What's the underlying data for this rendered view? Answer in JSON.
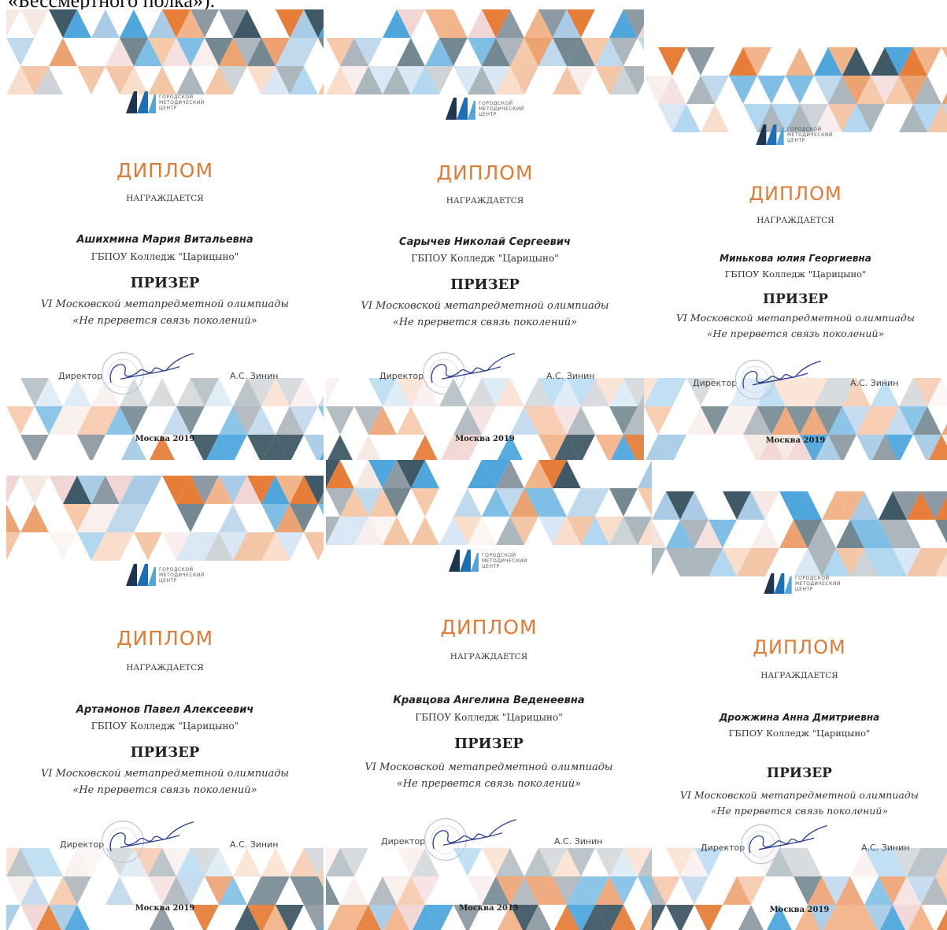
{
  "caption": "«Бессмертного полка»).",
  "diplomas": [
    {
      "title": "ДИПЛОМ",
      "subtitle": "НАГРАЖДАЕТСЯ",
      "logo_text": "ГОРОДСКОЙ МЕТОДИЧЕСКИЙ ЦЕНТР",
      "name": "Ашихмина Мария Витальевна",
      "org": "ГБПОУ Колледж \"Царицыно\"",
      "prize": "ПРИЗЕР",
      "event_line1": "VI Московской метапредметной олимпиады",
      "event_line2": "«Не прервется связь поколений»",
      "director_label": "Директор",
      "signer": "А.С. Зинин",
      "city_year": "Москва 2019"
    },
    {
      "title": "ДИПЛОМ",
      "subtitle": "НАГРАЖДАЕТСЯ",
      "logo_text": "ГОРОДСКОЙ МЕТОДИЧЕСКИЙ ЦЕНТР",
      "name": "Сарычев Николай Сергеевич",
      "org": "ГБПОУ Колледж \"Царицыно\"",
      "prize": "ПРИЗЕР",
      "event_line1": "VI Московской метапредметной олимпиады",
      "event_line2": "«Не прервется связь поколений»",
      "director_label": "Директор",
      "signer": "А.С. Зинин",
      "city_year": "Москва 2019"
    },
    {
      "title": "ДИПЛОМ",
      "subtitle": "НАГРАЖДАЕТСЯ",
      "logo_text": "ГОРОДСКОЙ МЕТОДИЧЕСКИЙ ЦЕНТР",
      "name": "Минькова юлия Георгиевна",
      "org": "ГБПОУ Колледж \"Царицыно\"",
      "prize": "ПРИЗЕР",
      "event_line1": "VI Московской метапредметной олимпиады",
      "event_line2": "«Не прервется связь поколений»",
      "director_label": "Директор",
      "signer": "А.С. Зинин",
      "city_year": "Москва 2019"
    },
    {
      "title": "ДИПЛОМ",
      "subtitle": "НАГРАЖДАЕТСЯ",
      "logo_text": "ГОРОДСКОЙ МЕТОДИЧЕСКИЙ ЦЕНТР",
      "name": "Артамонов Павел Алексеевич",
      "org": "ГБПОУ Колледж \"Царицыно\"",
      "prize": "ПРИЗЕР",
      "event_line1": "VI Московской метапредметной олимпиады",
      "event_line2": "«Не прервется связь поколений»",
      "director_label": "Директор",
      "signer": "А.С. Зинин",
      "city_year": "Москва 2019"
    },
    {
      "title": "ДИПЛОМ",
      "subtitle": "НАГРАЖДАЕТСЯ",
      "logo_text": "ГОРОДСКОЙ МЕТОДИЧЕСКИЙ ЦЕНТР",
      "name": "Кравцова Ангелина Веденеевна",
      "org": "ГБПОУ Колледж \"Царицыно\"",
      "prize": "ПРИЗЕР",
      "event_line1": "VI Московской метапредметной олимпиады",
      "event_line2": "«Не прервется связь поколений»",
      "director_label": "Директор",
      "signer": "А.С. Зинин",
      "city_year": "Москва 2019"
    },
    {
      "title": "ДИПЛОМ",
      "subtitle": "НАГРАЖДАЕТСЯ",
      "logo_text": "ГОРОДСКОЙ МЕТОДИЧЕСКИЙ ЦЕНТР",
      "name": "Дрожжина Анна Дмитриевна",
      "org": "ГБПОУ Колледж \"Царицыно\"",
      "prize": "ПРИЗЕР",
      "event_line1": "VI Московской метапредметной олимпиады",
      "event_line2": "«Не прервется связь поколений»",
      "director_label": "Директор",
      "signer": "А.С. Зинин",
      "city_year": "Москва 2019"
    }
  ],
  "colors": {
    "title": "#e07a34",
    "orange": "#e67e3a",
    "peach": "#f2b48a",
    "blue": "#4ea6dc",
    "light_blue": "#a9cbe6",
    "grey": "#8e9aa3",
    "dark_teal": "#3f5a66",
    "pink": "#f2d6d6",
    "logo_blue": "#1a6fb5",
    "logo_dark": "#1e3550"
  }
}
